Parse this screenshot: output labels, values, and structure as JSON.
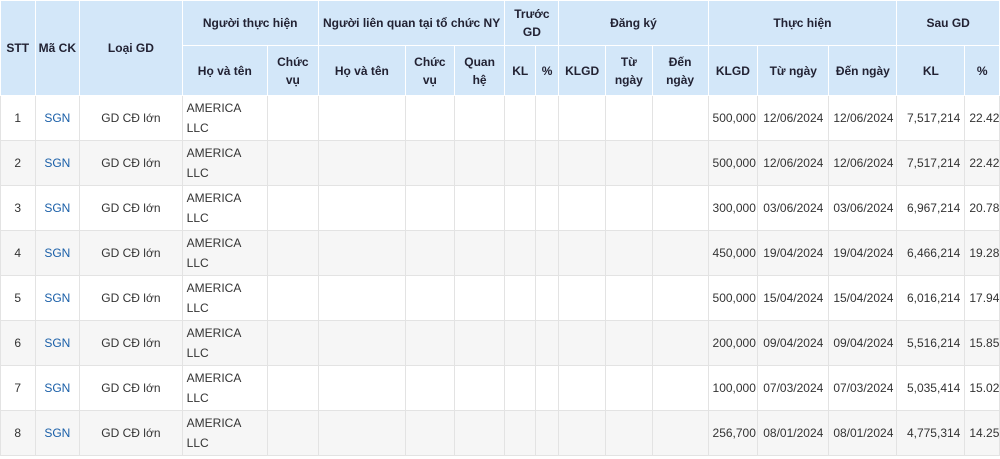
{
  "headers": {
    "stt": "STT",
    "ma_ck": "Mã CK",
    "loai_gd": "Loại GD",
    "nguoi_thuc_hien": "Người thực hiện",
    "nguoi_lien_quan": "Người liên quan tại tổ chức NY",
    "truoc_gd": "Trước GD",
    "dang_ky": "Đăng ký",
    "thuc_hien": "Thực hiện",
    "sau_gd": "Sau GD",
    "ho_va_ten": "Họ và tên",
    "chuc_vu": "Chức vụ",
    "ho_va_ten_2": "Họ và tên",
    "chuc_vu_2": "Chức vụ",
    "quan_he": "Quan hệ",
    "kl": "KL",
    "pct": "%",
    "klgd": "KLGD",
    "tu_ngay": "Từ ngày",
    "den_ngay": "Đến ngày",
    "klgd_2": "KLGD",
    "tu_ngay_2": "Từ ngày",
    "den_ngay_2": "Đến ngày",
    "kl_2": "KL",
    "pct_2": "%"
  },
  "rows": [
    {
      "stt": "1",
      "code": "SGN",
      "type": "GD CĐ lớn",
      "name": "AMERICA LLC",
      "klgd": "500,000",
      "from": "12/06/2024",
      "to": "12/06/2024",
      "after_kl": "7,517,214",
      "after_pct": "22.42"
    },
    {
      "stt": "2",
      "code": "SGN",
      "type": "GD CĐ lớn",
      "name": "AMERICA LLC",
      "klgd": "500,000",
      "from": "12/06/2024",
      "to": "12/06/2024",
      "after_kl": "7,517,214",
      "after_pct": "22.42"
    },
    {
      "stt": "3",
      "code": "SGN",
      "type": "GD CĐ lớn",
      "name": "AMERICA LLC",
      "klgd": "300,000",
      "from": "03/06/2024",
      "to": "03/06/2024",
      "after_kl": "6,967,214",
      "after_pct": "20.78"
    },
    {
      "stt": "4",
      "code": "SGN",
      "type": "GD CĐ lớn",
      "name": "AMERICA LLC",
      "klgd": "450,000",
      "from": "19/04/2024",
      "to": "19/04/2024",
      "after_kl": "6,466,214",
      "after_pct": "19.28"
    },
    {
      "stt": "5",
      "code": "SGN",
      "type": "GD CĐ lớn",
      "name": "AMERICA LLC",
      "klgd": "500,000",
      "from": "15/04/2024",
      "to": "15/04/2024",
      "after_kl": "6,016,214",
      "after_pct": "17.94"
    },
    {
      "stt": "6",
      "code": "SGN",
      "type": "GD CĐ lớn",
      "name": "AMERICA LLC",
      "klgd": "200,000",
      "from": "09/04/2024",
      "to": "09/04/2024",
      "after_kl": "5,516,214",
      "after_pct": "15.85"
    },
    {
      "stt": "7",
      "code": "SGN",
      "type": "GD CĐ lớn",
      "name": "AMERICA LLC",
      "klgd": "100,000",
      "from": "07/03/2024",
      "to": "07/03/2024",
      "after_kl": "5,035,414",
      "after_pct": "15.02"
    },
    {
      "stt": "8",
      "code": "SGN",
      "type": "GD CĐ lớn",
      "name": "AMERICA LLC",
      "klgd": "256,700",
      "from": "08/01/2024",
      "to": "08/01/2024",
      "after_kl": "4,775,314",
      "after_pct": "14.25"
    }
  ],
  "colors": {
    "header_bg": "#d3e7f9",
    "code_link": "#1a5fa8",
    "row_alt": "#f6f6f6"
  }
}
